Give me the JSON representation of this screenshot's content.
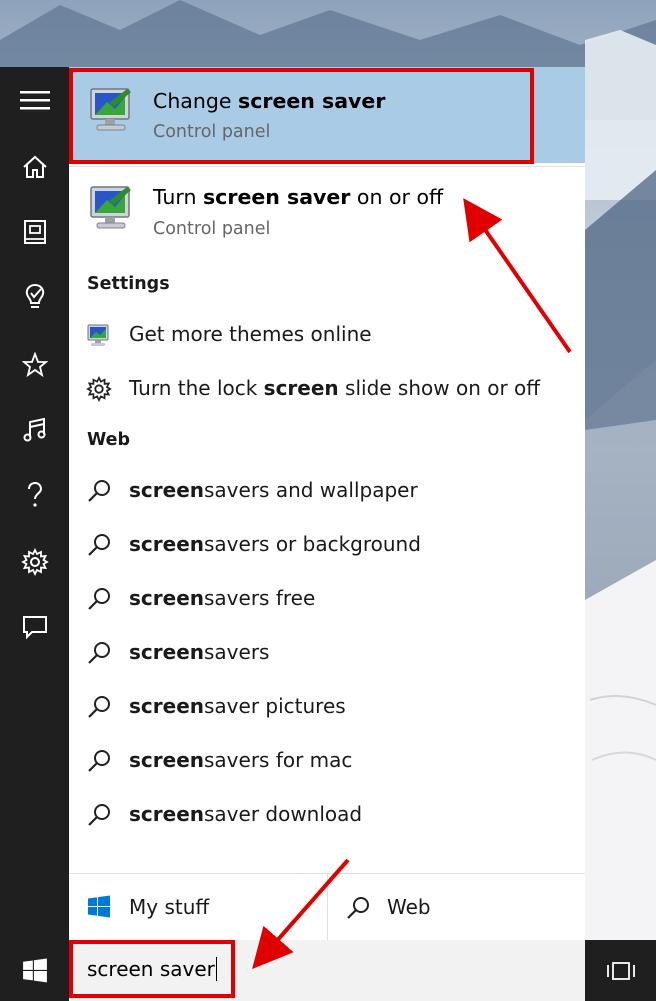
{
  "results": [
    {
      "title_prefix": "Change ",
      "title_bold": "screen saver",
      "title_suffix": "",
      "subtitle": "Control panel",
      "icon": "screen-saver-icon"
    },
    {
      "title_prefix": "Turn ",
      "title_bold": "screen saver",
      "title_suffix": " on or off",
      "subtitle": "Control panel",
      "icon": "screen-saver-icon"
    }
  ],
  "settings": {
    "header": "Settings",
    "items": [
      {
        "prefix": "Get more themes online",
        "bold": "",
        "suffix": "",
        "icon": "themes-icon"
      },
      {
        "prefix": "Turn the lock ",
        "bold": "screen",
        "suffix": " slide show on or off",
        "icon": "gear-icon"
      }
    ]
  },
  "web": {
    "header": "Web",
    "items": [
      {
        "bold": "screen",
        "rest": "savers and wallpaper"
      },
      {
        "bold": "screen",
        "rest": "savers or background"
      },
      {
        "bold": "screen",
        "rest": "savers free"
      },
      {
        "bold": "screen",
        "rest": "savers"
      },
      {
        "bold": "screen",
        "rest": "saver pictures"
      },
      {
        "bold": "screen",
        "rest": "savers for mac"
      },
      {
        "bold": "screen",
        "rest": "saver download"
      }
    ]
  },
  "scope": {
    "my_stuff": "My stuff",
    "web": "Web"
  },
  "search": {
    "value": "screen saver"
  },
  "rail_icons": [
    "menu-icon",
    "home-icon",
    "notebook-icon",
    "lightbulb-icon",
    "star-icon",
    "music-icon",
    "help-icon",
    "gear-icon",
    "feedback-icon"
  ],
  "colors": {
    "selected_bg": "#aacbe6",
    "rail_bg": "#1f1f1f",
    "annotation": "#e00000"
  }
}
